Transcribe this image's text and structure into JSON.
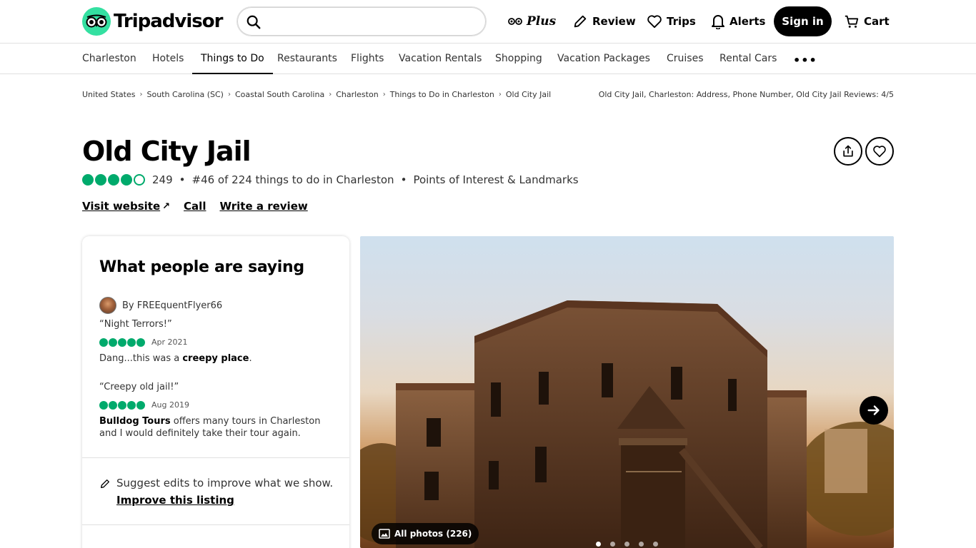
{
  "header": {
    "logo_text": "Tripadvisor",
    "search_placeholder": "",
    "plus_label": "Plus",
    "review_label": "Review",
    "trips_label": "Trips",
    "alerts_label": "Alerts",
    "signin_label": "Sign in",
    "cart_label": "Cart"
  },
  "subnav": {
    "items": [
      "Charleston",
      "Hotels",
      "Things to Do",
      "Restaurants",
      "Flights",
      "Vacation Rentals",
      "Shopping",
      "Vacation Packages",
      "Cruises",
      "Rental Cars"
    ],
    "active": "Things to Do",
    "more": "•••"
  },
  "breadcrumb": {
    "items": [
      "United States",
      "South Carolina (SC)",
      "Coastal South Carolina",
      "Charleston",
      "Things to Do in Charleston",
      "Old City Jail"
    ],
    "page_heading": "Old City Jail, Charleston: Address, Phone Number, Old City Jail Reviews: 4/5"
  },
  "attraction": {
    "title": "Old City Jail",
    "rating": 4.0,
    "review_count": "249",
    "rank": "#46 of 224 things to do in Charleston",
    "category": "Points of Interest & Landmarks",
    "visit_website": "Visit website",
    "visit_website_icon": "↗",
    "call": "Call",
    "write_review": "Write a review"
  },
  "reviews_card": {
    "title": "What people are saying",
    "reviewer": "By FREEquentFlyer66",
    "reviews": [
      {
        "title": "“Night Terrors!”",
        "rating": 5,
        "date": "Apr 2021",
        "text_before": "Dang...this was a ",
        "text_bold": "creepy place",
        "text_after": "."
      },
      {
        "title": "“Creepy old jail!”",
        "rating": 5,
        "date": "Aug 2019",
        "text_before": "",
        "text_bold": "Bulldog Tours",
        "text_after": " offers many tours in Charleston and I would definitely take their tour again."
      }
    ],
    "suggest_text": "Suggest edits to improve what we show.",
    "improve_link": "Improve this listing"
  },
  "photo": {
    "all_photos_label": "All photos (226)",
    "dot_count": 5,
    "active_dot": 0
  },
  "colors": {
    "brand_green": "#34e0a1",
    "rating_green": "#00aa6c"
  }
}
